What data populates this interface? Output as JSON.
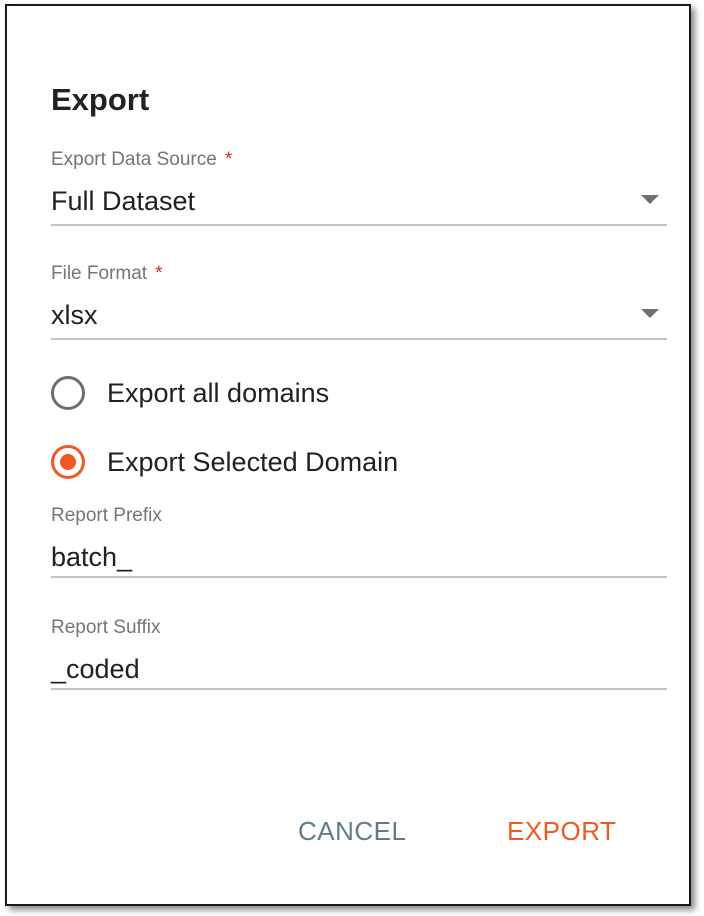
{
  "dialog": {
    "title": "Export"
  },
  "data_source": {
    "label": "Export Data Source",
    "required_mark": "*",
    "value": "Full Dataset"
  },
  "file_format": {
    "label": "File Format",
    "required_mark": "*",
    "value": "xlsx"
  },
  "domain_options": [
    {
      "label": "Export all domains",
      "selected": false
    },
    {
      "label": "Export Selected Domain",
      "selected": true
    }
  ],
  "report_prefix": {
    "label": "Report Prefix",
    "value": "batch_"
  },
  "report_suffix": {
    "label": "Report Suffix",
    "value": "_coded"
  },
  "actions": {
    "cancel_label": "CANCEL",
    "export_label": "EXPORT"
  },
  "colors": {
    "accent": "#ef5a24",
    "cancel": "#5f7c8c",
    "required": "#d32f2f"
  }
}
